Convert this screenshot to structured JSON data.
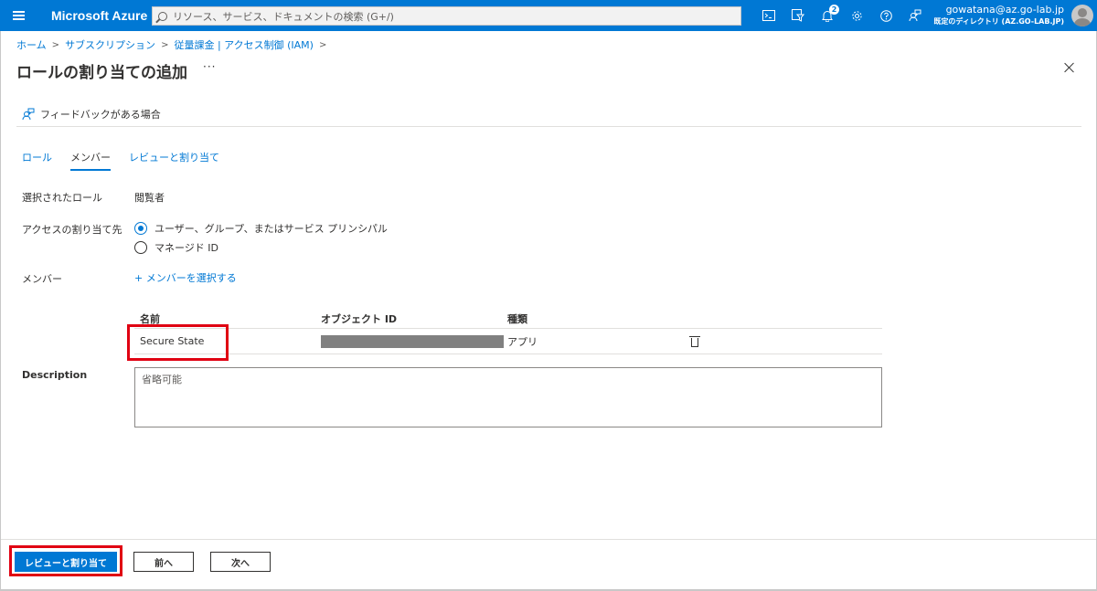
{
  "topbar": {
    "brand": "Microsoft Azure",
    "search_placeholder": "リソース、サービス、ドキュメントの検索 (G+/)",
    "notification_count": "2",
    "account_email": "gowatana@az.go-lab.jp",
    "account_directory": "既定のディレクトリ (AZ.GO-LAB.JP)",
    "accent_color": "#0078d4"
  },
  "breadcrumb": {
    "items": [
      "ホーム",
      "サブスクリプション",
      "従量課金 | アクセス制御 (IAM)"
    ]
  },
  "page": {
    "title": "ロールの割り当ての追加",
    "more": "···",
    "feedback": "フィードバックがある場合"
  },
  "tabs": [
    {
      "label": "ロール"
    },
    {
      "label": "メンバー"
    },
    {
      "label": "レビューと割り当て"
    }
  ],
  "form": {
    "selected_role_label": "選択されたロール",
    "selected_role_value": "閲覧者",
    "assign_to_label": "アクセスの割り当て先",
    "options": [
      {
        "label": "ユーザー、グループ、またはサービス プリンシパル",
        "selected": true
      },
      {
        "label": "マネージド ID",
        "selected": false
      }
    ],
    "members_label": "メンバー",
    "add_members": "+ メンバーを選択する",
    "table": {
      "headers": [
        "名前",
        "オブジェクト ID",
        "種類"
      ],
      "rows": [
        {
          "name": "Secure State",
          "type": "アプリ"
        }
      ]
    },
    "description_label": "Description",
    "description_placeholder": "省略可能"
  },
  "footer": {
    "review_assign": "レビューと割り当て",
    "prev": "前へ",
    "next": "次へ"
  }
}
